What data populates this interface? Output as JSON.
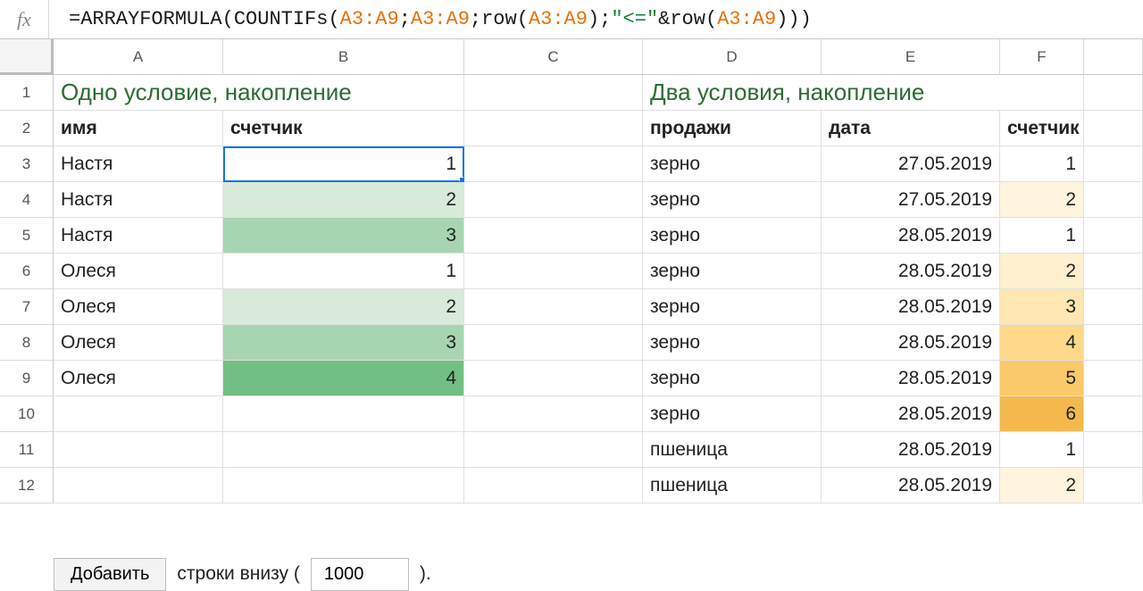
{
  "formula_bar": {
    "fx_label": "fx",
    "prefix": "=",
    "fn_outer": "ARRAYFORMULA",
    "fn_inner": "COUNTIFs",
    "fn_row": "row",
    "ref": "A3:A9",
    "sep": ";",
    "str_part": "\"<=\"",
    "amp": "&"
  },
  "columns": [
    "A",
    "B",
    "C",
    "D",
    "E",
    "F",
    ""
  ],
  "row_labels": [
    "1",
    "2",
    "3",
    "4",
    "5",
    "6",
    "7",
    "8",
    "9",
    "10",
    "11",
    "12"
  ],
  "title_left": "Одно условие, накопление",
  "title_right": "Два условия, накопление",
  "headers_left": {
    "name": "имя",
    "counter": "счетчик"
  },
  "headers_right": {
    "sales": "продажи",
    "date": "дата",
    "counter": "счетчик"
  },
  "left_rows": [
    {
      "name": "Настя",
      "counter": 1,
      "bg": "#ffffff"
    },
    {
      "name": "Настя",
      "counter": 2,
      "bg": "#d8ead9"
    },
    {
      "name": "Настя",
      "counter": 3,
      "bg": "#a8d5b1"
    },
    {
      "name": "Олеся",
      "counter": 1,
      "bg": "#ffffff"
    },
    {
      "name": "Олеся",
      "counter": 2,
      "bg": "#d8ead9"
    },
    {
      "name": "Олеся",
      "counter": 3,
      "bg": "#a8d5b1"
    },
    {
      "name": "Олеся",
      "counter": 4,
      "bg": "#72bf83"
    }
  ],
  "right_rows": [
    {
      "sales": "зерно",
      "date": "27.05.2019",
      "counter": 1,
      "bg": "#ffffff"
    },
    {
      "sales": "зерно",
      "date": "27.05.2019",
      "counter": 2,
      "bg": "#fff4dd"
    },
    {
      "sales": "зерно",
      "date": "28.05.2019",
      "counter": 1,
      "bg": "#ffffff"
    },
    {
      "sales": "зерно",
      "date": "28.05.2019",
      "counter": 2,
      "bg": "#fff0d0"
    },
    {
      "sales": "зерно",
      "date": "28.05.2019",
      "counter": 3,
      "bg": "#ffe6b3"
    },
    {
      "sales": "зерно",
      "date": "28.05.2019",
      "counter": 4,
      "bg": "#ffd98a"
    },
    {
      "sales": "зерно",
      "date": "28.05.2019",
      "counter": 5,
      "bg": "#f9c96a"
    },
    {
      "sales": "зерно",
      "date": "28.05.2019",
      "counter": 6,
      "bg": "#f4b94c"
    },
    {
      "sales": "пшеница",
      "date": "28.05.2019",
      "counter": 1,
      "bg": "#ffffff"
    },
    {
      "sales": "пшеница",
      "date": "28.05.2019",
      "counter": 2,
      "bg": "#fff4dd"
    }
  ],
  "footer": {
    "add_button": "Добавить",
    "rows_below": "строки внизу (",
    "rows_value": "1000",
    "closing": ")."
  }
}
